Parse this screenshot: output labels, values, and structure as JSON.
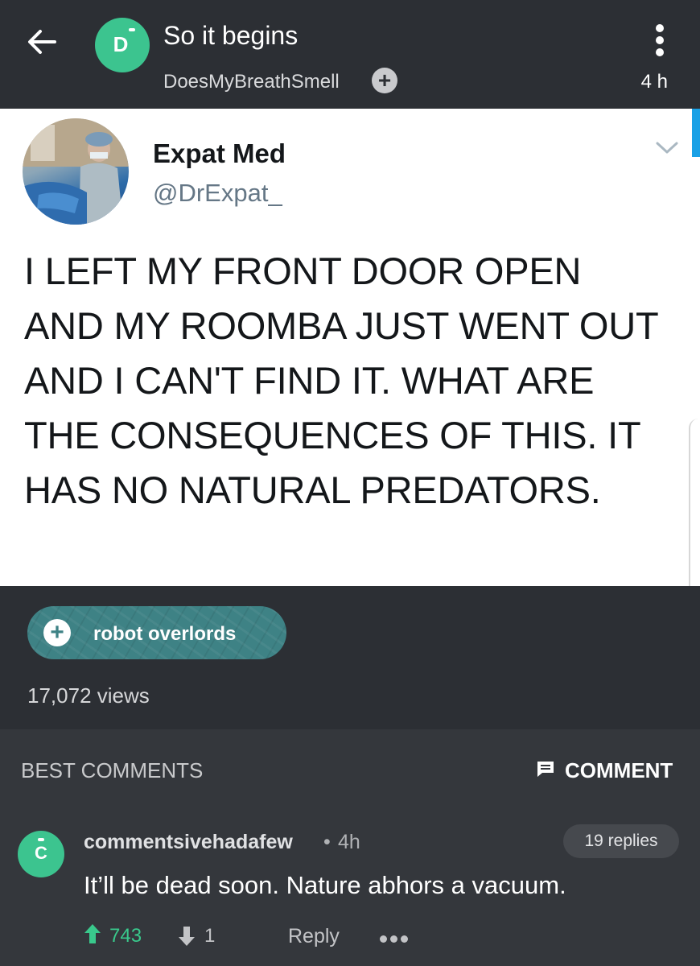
{
  "header": {
    "avatar_letter": "D",
    "title": "So it begins",
    "username": "DoesMyBreathSmell",
    "age": "4 h"
  },
  "tweet": {
    "name": "Expat Med",
    "handle": "@DrExpat_",
    "text": "I LEFT MY FRONT DOOR OPEN AND MY ROOMBA JUST WENT OUT AND I CAN'T FIND IT. WHAT ARE THE CONSEQUENCES OF THIS. IT HAS NO NATURAL PREDATORS."
  },
  "post_meta": {
    "tag_label": "robot overlords",
    "views": "17,072 views"
  },
  "comments_section": {
    "heading": "BEST COMMENTS",
    "comment_button_label": "COMMENT",
    "comments": [
      {
        "avatar_letter": "C",
        "author": "commentsivehadafew",
        "separator": "•",
        "time": "4h",
        "replies": "19 replies",
        "text": "It’ll be dead soon. Nature abhors a vacuum.",
        "upvotes": "743",
        "downvotes": "1",
        "reply_label": "Reply"
      }
    ]
  },
  "colors": {
    "accent_green": "#3cc48f",
    "upvote_green": "#39c98c",
    "tag_teal": "#3e8285",
    "header_bg": "#2c2f34",
    "comments_bg": "#34373c"
  },
  "icons": [
    "arrow-back-icon",
    "more-vertical-icon",
    "plus-icon",
    "chevron-down-icon",
    "comment-icon",
    "upvote-arrow-icon",
    "downvote-arrow-icon",
    "more-horizontal-icon"
  ]
}
